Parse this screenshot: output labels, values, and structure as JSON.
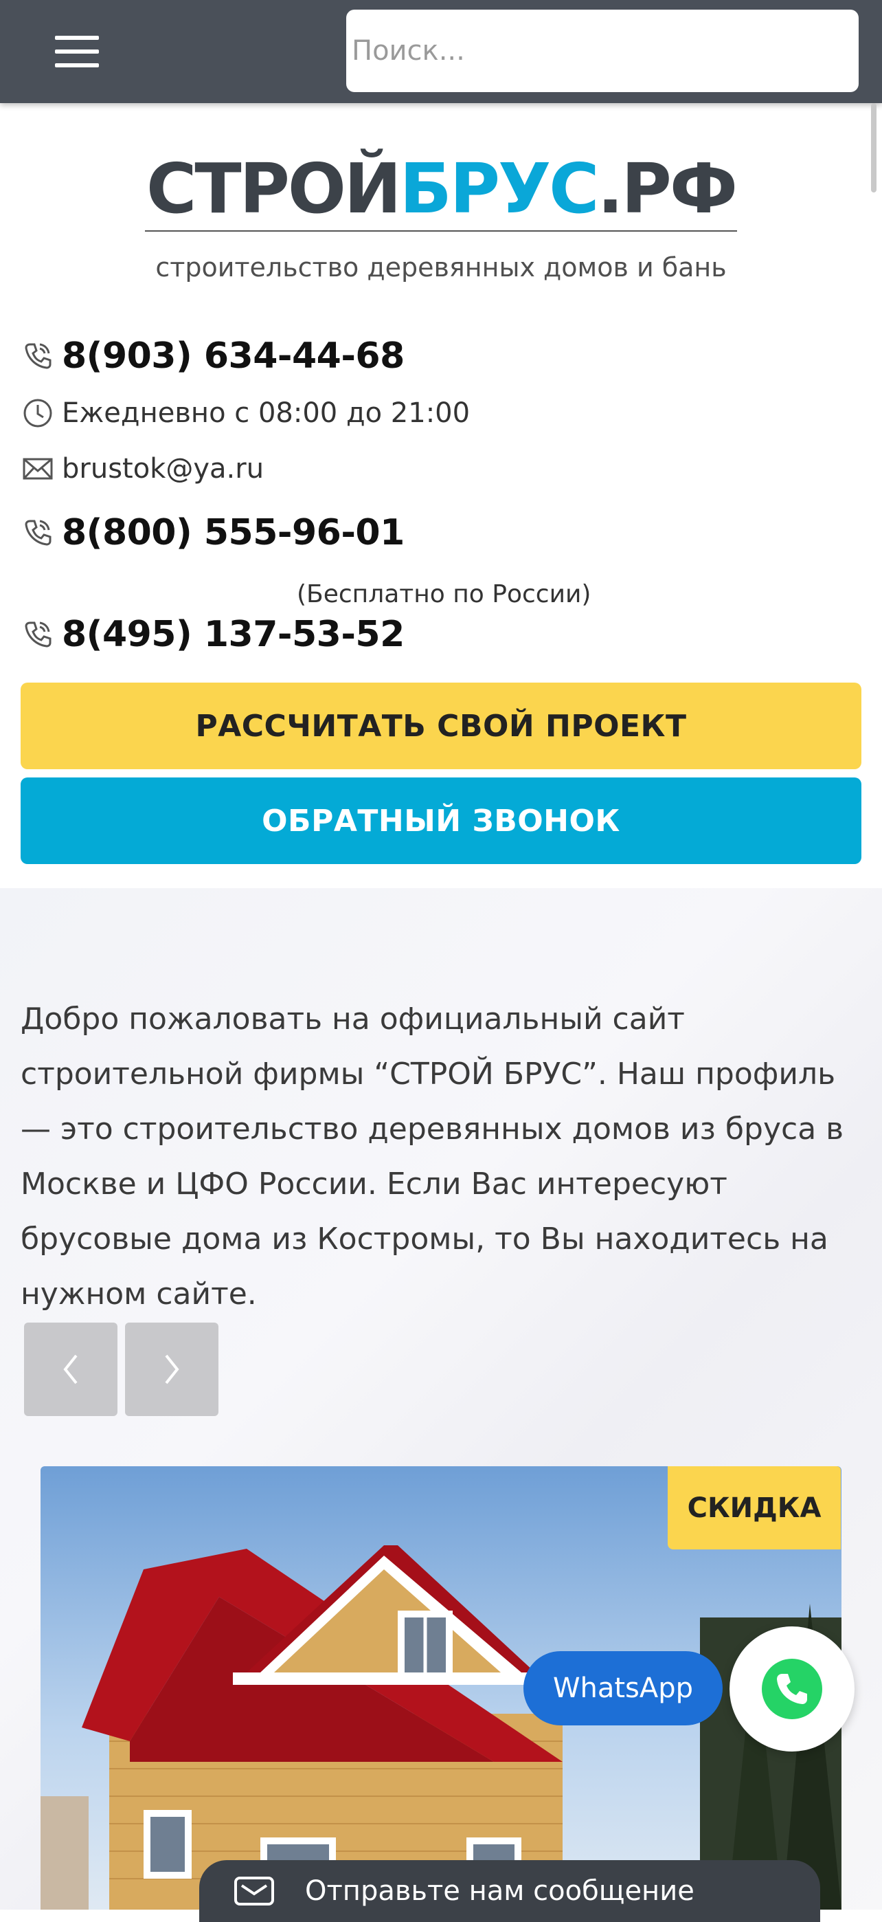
{
  "header": {
    "search_placeholder": "Поиск..."
  },
  "logo": {
    "part1": "СТРОЙ",
    "part2": "БРУС",
    "part3": ".РФ",
    "tagline": "строительство деревянных домов и бань"
  },
  "contacts": {
    "phone1": "8(903) 634-44-68",
    "hours": "Ежедневно с 08:00 до 21:00",
    "email": "brustok@ya.ru",
    "phone2": "8(800) 555-96-01",
    "phone2_note": "(Бесплатно по России)",
    "phone3": "8(495) 137-53-52"
  },
  "buttons": {
    "calculate": "РАССЧИТАТЬ СВОЙ ПРОЕКТ",
    "callback": "ОБРАТНЫЙ ЗВОНОК"
  },
  "welcome": {
    "text": "Добро пожаловать на официальный сайт строительной фирмы “СТРОЙ БРУС”. Наш профиль — это строительство деревянных домов из бруса в Москве и ЦФО России. Если Вас интересуют брусовые дома из Костромы, то Вы находитесь на нужном сайте."
  },
  "card": {
    "badge": "СКИДКА"
  },
  "widgets": {
    "whatsapp_label": "WhatsApp",
    "message_label": "Отправьте нам сообщение"
  },
  "colors": {
    "header_bg": "#4a5059",
    "brand_dark": "#3c4249",
    "brand_blue": "#0aa7d8",
    "yellow": "#fbd54e",
    "cyan": "#04aad6",
    "whatsapp_green": "#25d366"
  }
}
